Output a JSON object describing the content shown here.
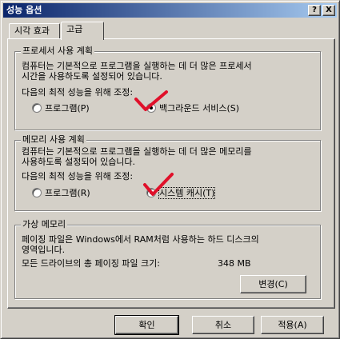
{
  "window": {
    "title": "성능 옵션",
    "help_button": "?",
    "close_button": "X"
  },
  "tabs": [
    {
      "label": "시각 효과"
    },
    {
      "label": "고급"
    }
  ],
  "processor": {
    "legend": "프로세서 사용 계획",
    "desc_line1": "컴퓨터는 기본적으로 프로그램을 실행하는 데 더 많은 프로세서",
    "desc_line2": "시간을 사용하도록 설정되어 있습니다.",
    "adjust_label": "다음의 최적 성능을 위해 조정:",
    "option_programs": "프로그램(P)",
    "option_background": "백그라운드 서비스(S)"
  },
  "memory": {
    "legend": "메모리 사용 계획",
    "desc_line1": "컴퓨터는 기본적으로 프로그램을 실행하는 데 더 많은 메모리를",
    "desc_line2": "사용하도록 설정되어 있습니다.",
    "adjust_label": "다음의 최적 성능을 위해 조정:",
    "option_programs": "프로그램(R)",
    "option_system_cache": "시스템 캐시(T)"
  },
  "virtual_memory": {
    "legend": "가상 메모리",
    "desc_line1": "페이징 파일은 Windows에서 RAM처럼 사용하는 하드 디스크의",
    "desc_line2": "영역입니다.",
    "total_label": "모든 드라이브의 총 페이징 파일 크기:",
    "total_value": "348 MB",
    "change_button": "변경(C)"
  },
  "footer": {
    "ok": "확인",
    "cancel": "취소",
    "apply": "적용(A)"
  },
  "colors": {
    "face": "#d4d0c8",
    "titlebar_start": "#0a246a",
    "titlebar_end": "#a6caf0",
    "checkmark": "#e0102a"
  }
}
